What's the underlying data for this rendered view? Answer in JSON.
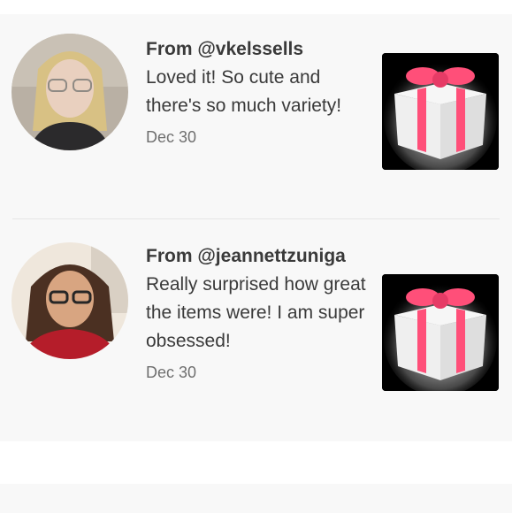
{
  "reviews": [
    {
      "from": "From @vkelssells",
      "message": "Loved it! So cute and there's so much variety!",
      "date": "Dec 30",
      "avatar_icon": "user-avatar-photo",
      "product_icon": "gift-box-icon"
    },
    {
      "from": "From @jeannettzuniga",
      "message": "Really surprised how great the items were! I am super obsessed!",
      "date": "Dec 30",
      "avatar_icon": "user-avatar-photo",
      "product_icon": "gift-box-icon"
    }
  ],
  "colors": {
    "ribbon": "#ff4f79",
    "gift_bg": "#000000",
    "panel_bg": "#f8f8f8"
  }
}
